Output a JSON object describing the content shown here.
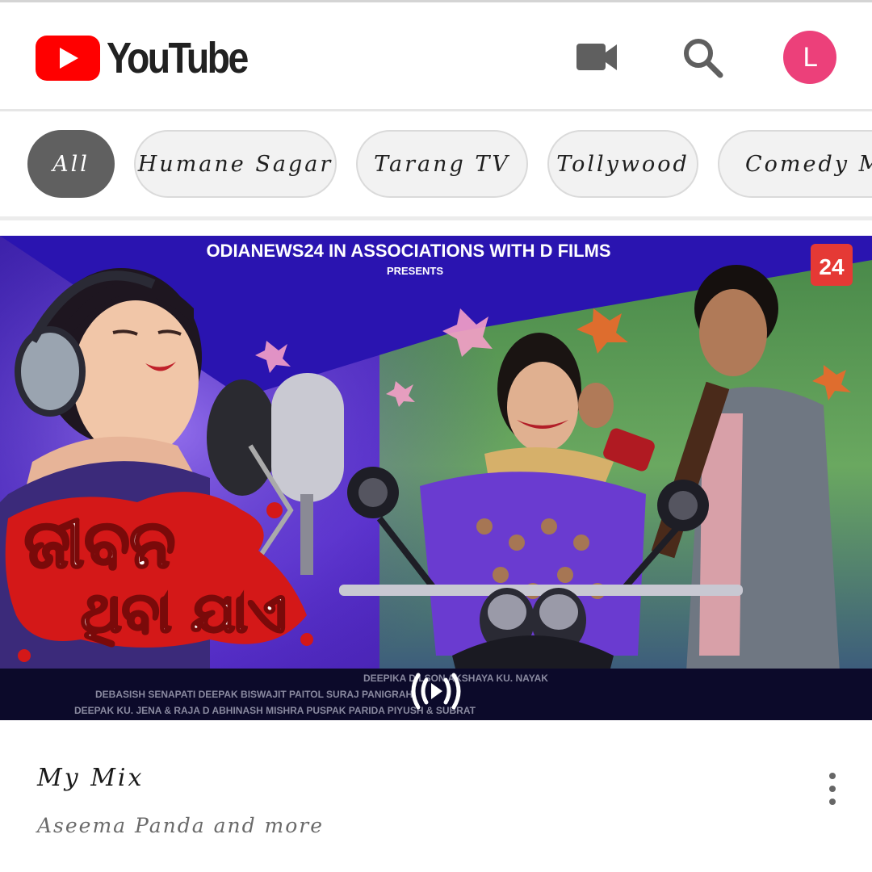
{
  "header": {
    "brand": "YouTube",
    "icons": {
      "camera": "video-camera-icon",
      "search": "search-icon"
    },
    "avatar_letter": "L"
  },
  "chips": [
    {
      "label": "All",
      "active": true
    },
    {
      "label": "Humane Sagar",
      "active": false
    },
    {
      "label": "Tarang TV",
      "active": false
    },
    {
      "label": "Tollywood",
      "active": false
    },
    {
      "label": "Comedy Movi",
      "active": false
    }
  ],
  "video": {
    "thumbnail_banner": "ODIANEWS24 IN ASSOCIATIONS WITH D FILMS",
    "thumbnail_presents": "PRESENTS",
    "thumbnail_badge": "24",
    "thumbnail_title_line1": "ଜୀବନ",
    "thumbnail_title_line2": "ଥିବା ଯାଏ",
    "credits_line1": "DEEPIKA DILSON   AKSHAYA KU. NAYAK",
    "credits_line2": "DEBASISH SENAPATI   DEEPAK   BISWAJIT PAITOL   SURAJ PANIGRAHI",
    "credits_line3": "DEEPAK KU. JENA & RAJA D   ABHINASH MISHRA   PUSPAK PARIDA   PIYUSH & SUBRAT",
    "mix_icon": "mix-play-icon",
    "title": "My Mix",
    "subtitle": "Aseema Panda and more",
    "menu_icon": "more-vertical-icon"
  },
  "colors": {
    "brand_red": "#ff0000",
    "avatar": "#ec407a",
    "chip_active": "#606060",
    "chip_bg": "#f2f2f2"
  }
}
